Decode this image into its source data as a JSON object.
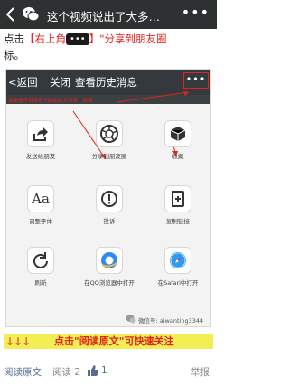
{
  "topbar": {
    "title": "这个视频说出了大多…",
    "back_icon": "chevron-left-icon",
    "chat_icon": "wechat-icon",
    "more_icon": "more-icon"
  },
  "article": {
    "line1_prefix": "点击",
    "line1_red_open": "【右上角",
    "line1_dots": "•••",
    "line1_red_close": "】\"分享到朋友圈",
    "line2": "标。"
  },
  "shot": {
    "back": "<返回",
    "close": "关闭",
    "title": "查看历史消息",
    "dots": "•••",
    "note": "如果看不到请按下面朋友分享来，谢谢",
    "tiles": [
      {
        "label": "发送给朋友",
        "icon": "share-arrow-icon"
      },
      {
        "label": "分享到朋友圈",
        "icon": "moments-icon"
      },
      {
        "label": "收藏",
        "icon": "cube-icon"
      },
      {
        "label": "调整字体",
        "icon": "font-size-icon"
      },
      {
        "label": "投诉",
        "icon": "complaint-icon"
      },
      {
        "label": "复制链接",
        "icon": "copy-link-icon"
      },
      {
        "label": "刷新",
        "icon": "refresh-icon"
      },
      {
        "label": "在QQ浏览器中打开",
        "icon": "qq-browser-icon"
      },
      {
        "label": "在Safari中打开",
        "icon": "safari-icon"
      }
    ],
    "watermark": "微信号: aiwanting3344"
  },
  "banner": {
    "arrows": "↓↓↓",
    "text": "点击\"阅读原文\"可快速关注"
  },
  "bottom": {
    "read_original": "阅读原文",
    "views": "阅读 2",
    "likes": "1",
    "report": "举报"
  },
  "colors": {
    "accent_red": "#e0241e",
    "link_blue": "#576b95",
    "banner_yellow": "#f4ee55"
  }
}
